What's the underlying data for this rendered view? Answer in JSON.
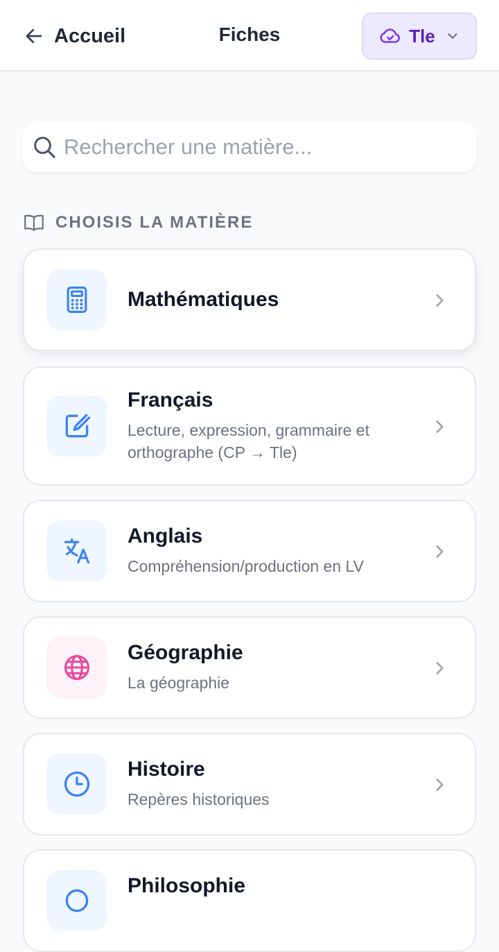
{
  "header": {
    "back_label": "Accueil",
    "title": "Fiches",
    "level": {
      "label": "Tle",
      "icon": "cloud-check-icon"
    }
  },
  "search": {
    "placeholder": "Rechercher une matière...",
    "value": ""
  },
  "section": {
    "label": "CHOISIS LA MATIÈRE",
    "icon": "book-open-icon"
  },
  "subjects": [
    {
      "title": "Mathématiques",
      "description": "",
      "icon": "calculator-icon",
      "icon_bg": "#eff6ff",
      "icon_color": "#3b82f6"
    },
    {
      "title": "Français",
      "description": "Lecture, expression, grammaire et orthographe (CP → Tle)",
      "icon": "edit-icon",
      "icon_bg": "#eff6ff",
      "icon_color": "#3b82f6"
    },
    {
      "title": "Anglais",
      "description": "Compréhension/production en LV",
      "icon": "translate-icon",
      "icon_bg": "#eff6ff",
      "icon_color": "#3b82f6"
    },
    {
      "title": "Géographie",
      "description": "La géographie",
      "icon": "globe-icon",
      "icon_bg": "#fdf2f8",
      "icon_color": "#ec4899"
    },
    {
      "title": "Histoire",
      "description": "Repères historiques",
      "icon": "clock-icon",
      "icon_bg": "#eff6ff",
      "icon_color": "#3b82f6"
    },
    {
      "title": "Philosophie",
      "description": "",
      "icon": "generic-icon",
      "icon_bg": "#eff6ff",
      "icon_color": "#3b82f6"
    }
  ],
  "colors": {
    "accent": "#5b21b6",
    "accent_bg": "#ede9fe",
    "background": "#f8fafc",
    "text": "#111827",
    "muted": "#6b7280"
  }
}
